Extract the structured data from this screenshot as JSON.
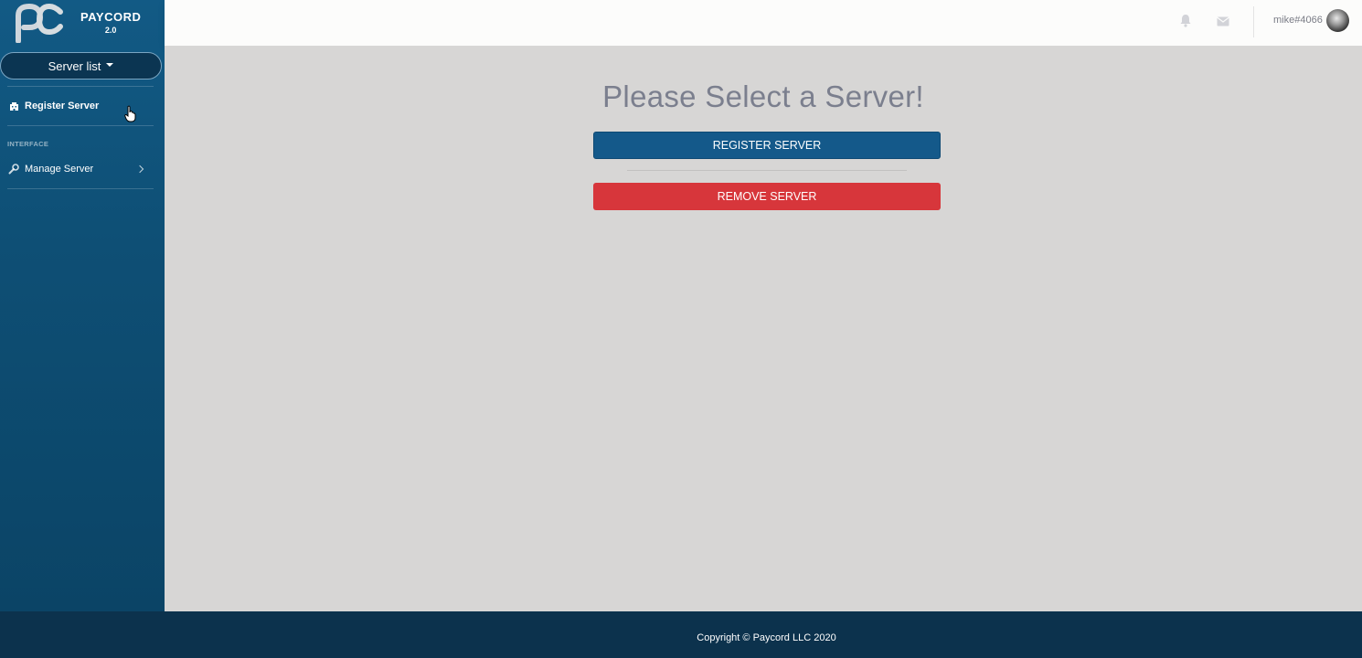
{
  "brand": {
    "name": "PAYCORD",
    "version": "2.0"
  },
  "sidebar": {
    "server_list_label": "Server list",
    "register_label": "Register Server",
    "section_interface": "INTERFACE",
    "manage_label": "Manage Server"
  },
  "topbar": {
    "username": "mike#4066"
  },
  "main": {
    "title": "Please Select a Server!",
    "register_button": "REGISTER SERVER",
    "remove_button": "REMOVE SERVER"
  },
  "footer": {
    "copyright": "Copyright © Paycord LLC 2020"
  },
  "colors": {
    "sidebar": "#125a85",
    "primary": "#14598a",
    "danger": "#d7363b",
    "footer": "#0c324d"
  },
  "icons": [
    "pc-logo-icon",
    "building-icon",
    "wrench-icon",
    "chevron-right-icon",
    "bell-icon",
    "envelope-icon",
    "cursor-hand-icon"
  ]
}
